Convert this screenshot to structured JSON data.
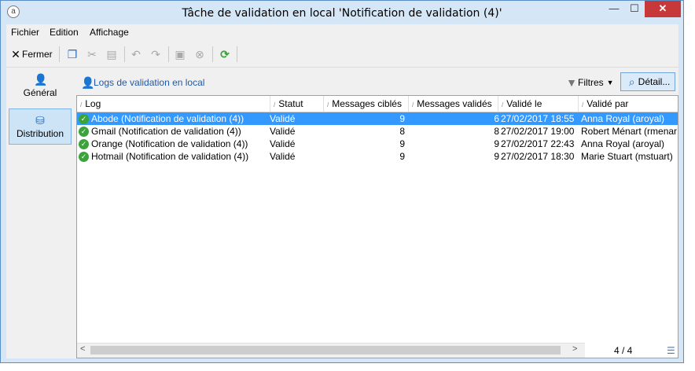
{
  "window": {
    "title": "Tâche de validation en local 'Notification de validation (4)'"
  },
  "menu": [
    "Fichier",
    "Edition",
    "Affichage"
  ],
  "toolbar": {
    "close_label": "Fermer"
  },
  "sidebar": {
    "items": [
      {
        "label": "Général",
        "active": false
      },
      {
        "label": "Distribution",
        "active": true
      }
    ]
  },
  "panel": {
    "title": "Logs de validation en local",
    "filter_label": "Filtres",
    "detail_label": "Détail..."
  },
  "table": {
    "columns": [
      "Log",
      "Statut",
      "Messages ciblés",
      "Messages validés",
      "Validé le",
      "Validé par"
    ],
    "rows": [
      {
        "log": "Abode (Notification de validation (4))",
        "status": "Validé",
        "targeted": "9",
        "validated": "6",
        "date": "27/02/2017 18:55",
        "by": "Anna Royal (aroyal)",
        "selected": true
      },
      {
        "log": "Gmail (Notification de validation (4))",
        "status": "Validé",
        "targeted": "8",
        "validated": "8",
        "date": "27/02/2017 19:00",
        "by": "Robert Ménart (rmenar",
        "selected": false
      },
      {
        "log": "Orange (Notification de validation (4))",
        "status": "Validé",
        "targeted": "9",
        "validated": "9",
        "date": "27/02/2017 22:43",
        "by": "Anna Royal (aroyal)",
        "selected": false
      },
      {
        "log": "Hotmail (Notification de validation (4))",
        "status": "Validé",
        "targeted": "9",
        "validated": "9",
        "date": "27/02/2017 18:30",
        "by": "Marie Stuart (mstuart)",
        "selected": false
      }
    ]
  },
  "footer": {
    "counter": "4 / 4"
  },
  "colors": {
    "selection": "#3399ff",
    "window_frame": "#d5e6f6",
    "close_button": "#c7383a",
    "link_blue": "#1e5aa8",
    "status_ok": "#3aa33a"
  }
}
